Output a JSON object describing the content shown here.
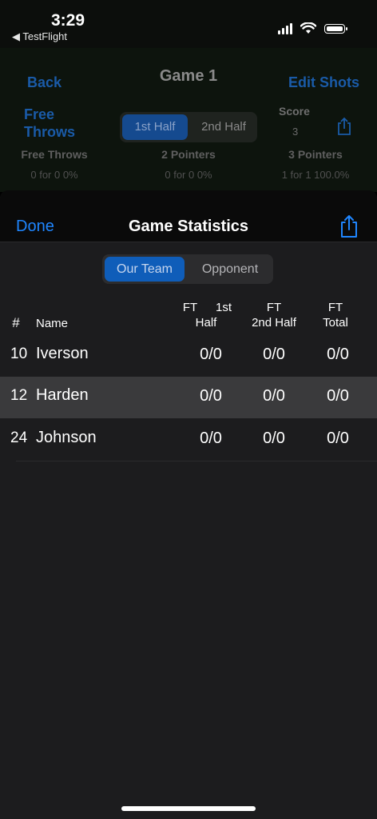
{
  "status_bar": {
    "time": "3:29",
    "back_app": "TestFlight"
  },
  "game_screen": {
    "back_label": "Back",
    "title": "Game 1",
    "edit_label": "Edit Shots",
    "free_throws_link": "Free Throws",
    "halves": [
      "1st Half",
      "2nd Half"
    ],
    "score_label": "Score",
    "score_value": "3",
    "columns": [
      {
        "label": "Free Throws",
        "value": "0 for 0  0%"
      },
      {
        "label": "2 Pointers",
        "value": "0 for 0  0%"
      },
      {
        "label": "3 Pointers",
        "value": "1 for 1  100.0%"
      }
    ]
  },
  "sheet": {
    "done_label": "Done",
    "title": "Game Statistics",
    "segments": [
      "Our Team",
      "Opponent"
    ],
    "headers": {
      "number": "#",
      "name": "Name",
      "ft1_a": "FT",
      "ft1_b": "1st",
      "ft1_c": "Half",
      "ft2_a": "FT",
      "ft2_b": "2nd Half",
      "ftt_a": "FT",
      "ftt_b": "Total"
    },
    "rows": [
      {
        "number": "10",
        "name": "Iverson",
        "ft1": "0/0",
        "ft2": "0/0",
        "total": "0/0"
      },
      {
        "number": "12",
        "name": "Harden",
        "ft1": "0/0",
        "ft2": "0/0",
        "total": "0/0"
      },
      {
        "number": "24",
        "name": "Johnson",
        "ft1": "0/0",
        "ft2": "0/0",
        "total": "0/0"
      }
    ]
  },
  "colors": {
    "accent": "#1f86ff",
    "selected_segment": "#0f5db9",
    "row_highlight": "#3a3a3c"
  }
}
